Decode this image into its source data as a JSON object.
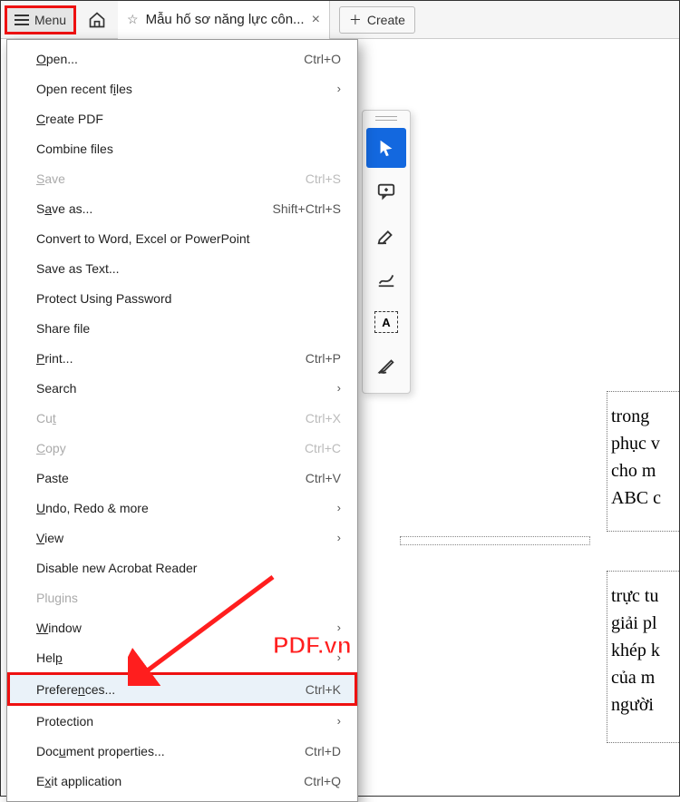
{
  "toolbar": {
    "menu_label": "Menu",
    "tab_title": "Mẫu hố sơ năng lực côn...",
    "create_label": "Create"
  },
  "menu": {
    "open": "Open...",
    "open_sc": "Ctrl+O",
    "open_recent": "Open recent files",
    "create_pdf": "Create PDF",
    "combine": "Combine files",
    "save": "Save",
    "save_sc": "Ctrl+S",
    "save_as": "Save as...",
    "save_as_sc": "Shift+Ctrl+S",
    "convert": "Convert to Word, Excel or PowerPoint",
    "save_text": "Save as Text...",
    "protect": "Protect Using Password",
    "share": "Share file",
    "print": "Print...",
    "print_sc": "Ctrl+P",
    "search": "Search",
    "cut": "Cut",
    "cut_sc": "Ctrl+X",
    "copy": "Copy",
    "copy_sc": "Ctrl+C",
    "paste": "Paste",
    "paste_sc": "Ctrl+V",
    "undo": "Undo, Redo & more",
    "view": "View",
    "disable": "Disable new Acrobat Reader",
    "plugins": "Plugins",
    "window": "Window",
    "help": "Help",
    "prefs": "Preferences...",
    "prefs_sc": "Ctrl+K",
    "protection": "Protection",
    "docprops": "Document properties...",
    "docprops_sc": "Ctrl+D",
    "exit": "Exit application",
    "exit_sc": "Ctrl+Q"
  },
  "tool_textbox_label": "A",
  "doc_lines_1": [
    "trong",
    "phục v",
    "cho m",
    "ABC c"
  ],
  "doc_lines_2": [
    "trực tu",
    "giải pl",
    "khép k",
    "của m",
    "người"
  ],
  "watermark": "PDF.vn"
}
